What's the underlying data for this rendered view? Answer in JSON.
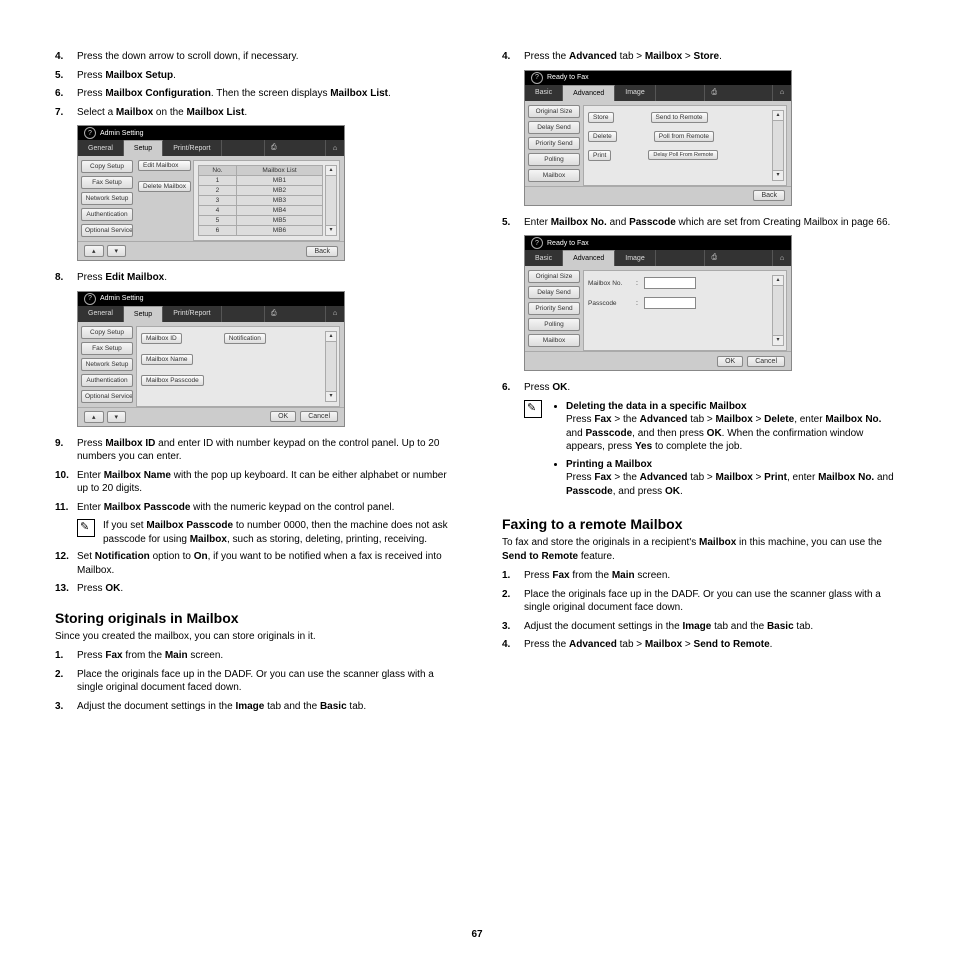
{
  "pagenum": "67",
  "left": {
    "steps_a": [
      {
        "n": "4.",
        "t": "Press the down arrow to scroll down, if necessary."
      },
      {
        "n": "5.",
        "t": "Press ",
        "b": "Mailbox Setup",
        "t2": "."
      },
      {
        "n": "6.",
        "t": "Press ",
        "b": "Mailbox Configuration",
        "t2": ". Then the screen displays ",
        "b2": "Mailbox List",
        "t3": "."
      },
      {
        "n": "7.",
        "t": "Select a ",
        "b": "Mailbox",
        "t2": " on the ",
        "b2": "Mailbox List",
        "t3": "."
      }
    ],
    "shot1": {
      "title": "Admin Setting",
      "tabs": [
        "General",
        "Setup",
        "Print/Report"
      ],
      "icons": [
        "⎙",
        "⌂"
      ],
      "sidebar": [
        "Copy Setup",
        "Fax Setup",
        "Network Setup",
        "Authentication",
        "Optional Service"
      ],
      "col_btns": [
        "Edit Mailbox",
        "Delete Mailbox"
      ],
      "table_h": [
        "No.",
        "Mailbox List"
      ],
      "table": [
        [
          "1",
          "MB1"
        ],
        [
          "2",
          "MB2"
        ],
        [
          "3",
          "MB3"
        ],
        [
          "4",
          "MB4"
        ],
        [
          "5",
          "MB5"
        ],
        [
          "6",
          "MB6"
        ]
      ],
      "back": "Back"
    },
    "step8": {
      "n": "8.",
      "t": "Press ",
      "b": "Edit Mailbox",
      "t2": "."
    },
    "shot2": {
      "title": "Admin Setting",
      "tabs": [
        "General",
        "Setup",
        "Print/Report"
      ],
      "icons": [
        "⎙",
        "⌂"
      ],
      "sidebar": [
        "Copy Setup",
        "Fax Setup",
        "Network Setup",
        "Authentication",
        "Optional Service"
      ],
      "fields": [
        "Mailbox ID",
        "Notification",
        "Mailbox Name",
        "Mailbox Passcode"
      ],
      "ok": "OK",
      "cancel": "Cancel"
    },
    "steps_b": [
      {
        "n": "9.",
        "html": "Press <b>Mailbox ID</b> and enter ID with number keypad on the control panel. Up to 20 numbers you can enter."
      },
      {
        "n": "10.",
        "html": "Enter <b>Mailbox Name</b> with the pop up keyboard. It can be either alphabet or number up to 20 digits."
      },
      {
        "n": "11.",
        "html": "Enter <b>Mailbox Passcode</b> with the numeric keypad on the control panel."
      }
    ],
    "note1": "If you set <b>Mailbox Passcode</b> to number 0000, then the machine does not ask passcode for using <b>Mailbox</b>, such as storing, deleting, printing, receiving.",
    "steps_c": [
      {
        "n": "12.",
        "html": "Set <b>Notification</b> option to <b>On</b>, if you want to be notified when a fax is received into Mailbox."
      },
      {
        "n": "13.",
        "html": "Press <b>OK</b>."
      }
    ],
    "h2a": "Storing originals in Mailbox",
    "intro_a": "Since you created the mailbox, you can store originals in it.",
    "steps_d": [
      {
        "n": "1.",
        "html": "Press <b>Fax</b> from the <b>Main</b> screen."
      },
      {
        "n": "2.",
        "html": "Place the originals face up in the DADF. Or you can use the scanner glass with a single original document faced down."
      },
      {
        "n": "3.",
        "html": "Adjust the document settings in the <b>Image</b> tab and the <b>Basic</b> tab."
      }
    ]
  },
  "right": {
    "step4": {
      "n": "4.",
      "html": "Press the <b>Advanced</b> tab > <b>Mailbox</b> > <b>Store</b>."
    },
    "shot3": {
      "title": "Ready to Fax",
      "tabs": [
        "Basic",
        "Advanced",
        "Image"
      ],
      "icons": [
        "⎙",
        "⌂"
      ],
      "sidebar": [
        "Original Size",
        "Delay Send",
        "Priority Send",
        "Polling",
        "Mailbox"
      ],
      "grid": [
        [
          "Store",
          "Send to Remote"
        ],
        [
          "Delete",
          "Poll from Remote"
        ],
        [
          "Print",
          "Delay Poll From Remote"
        ]
      ],
      "back": "Back"
    },
    "step5": {
      "n": "5.",
      "html": "Enter <b>Mailbox No.</b> and <b>Passcode</b> which are set from Creating Mailbox in page 66."
    },
    "shot4": {
      "title": "Ready to Fax",
      "tabs": [
        "Basic",
        "Advanced",
        "Image"
      ],
      "icons": [
        "⎙",
        "⌂"
      ],
      "sidebar": [
        "Original Size",
        "Delay Send",
        "Priority Send",
        "Polling",
        "Mailbox"
      ],
      "fields": [
        {
          "lbl": "Mailbox No.",
          "sep": ":"
        },
        {
          "lbl": "Passcode",
          "sep": ":"
        }
      ],
      "ok": "OK",
      "cancel": "Cancel"
    },
    "step6": {
      "n": "6.",
      "html": "Press <b>OK</b>."
    },
    "note2": {
      "items": [
        {
          "h": "Deleting the data in a specific Mailbox",
          "b": "Press <b>Fax</b> > the <b>Advanced</b> tab > <b>Mailbox</b> > <b>Delete</b>, enter <b>Mailbox No.</b> and <b>Passcode</b>, and then press <b>OK</b>. When the confirmation window appears, press <b>Yes</b> to complete the job."
        },
        {
          "h": "Printing a Mailbox",
          "b": "Press <b>Fax</b> > the <b>Advanced</b> tab > <b>Mailbox</b> > <b>Print</b>, enter <b>Mailbox No.</b> and <b>Passcode</b>, and press <b>OK</b>."
        }
      ]
    },
    "h2b": "Faxing to a remote Mailbox",
    "intro_b": "To fax and store the originals in a recipient's <b>Mailbox</b> in this machine, you can use the <b>Send to Remote</b> feature.",
    "steps_e": [
      {
        "n": "1.",
        "html": "Press <b>Fax</b> from the <b>Main</b> screen."
      },
      {
        "n": "2.",
        "html": "Place the originals face up in the DADF. Or you can use the scanner glass with a single original document face down."
      },
      {
        "n": "3.",
        "html": "Adjust the document settings in the <b>Image</b> tab and the <b>Basic</b> tab."
      },
      {
        "n": "4.",
        "html": "Press the <b>Advanced</b> tab > <b>Mailbox</b> > <b>Send to Remote</b>."
      }
    ]
  }
}
